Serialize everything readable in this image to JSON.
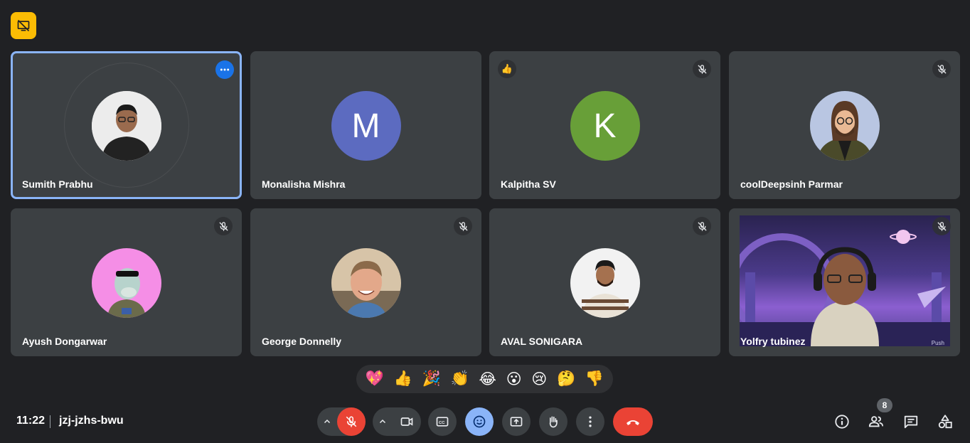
{
  "meeting": {
    "time": "11:22",
    "code": "jzj-jzhs-bwu",
    "participant_count": "8"
  },
  "participants": [
    {
      "name": "Sumith Prabhu"
    },
    {
      "name": "Monalisha Mishra",
      "initial": "M",
      "color": "#5c6bc0"
    },
    {
      "name": "Kalpitha SV",
      "initial": "K",
      "color": "#689f38",
      "reaction": "👍"
    },
    {
      "name": "coolDeepsinh Parmar"
    },
    {
      "name": "Ayush Dongarwar"
    },
    {
      "name": "George Donnelly"
    },
    {
      "name": "AVAL SONIGARA"
    },
    {
      "name": "Yolfry tubinez",
      "watermark": "Push"
    }
  ],
  "reactions": [
    "💖",
    "👍",
    "🎉",
    "👏",
    "😂",
    "😮",
    "😢",
    "🤔",
    "👎"
  ],
  "icons": {
    "presenting": "no-presenting-icon",
    "mic": "mic-off-icon",
    "camera": "videocam-icon",
    "captions": "closed-caption-icon",
    "emoji": "emoji-icon",
    "present": "present-screen-icon",
    "hand": "raise-hand-icon",
    "more": "more-vert-icon",
    "leave": "call-end-icon",
    "info": "info-icon",
    "people": "people-icon",
    "chat": "chat-icon",
    "activities": "activities-icon"
  },
  "colors": {
    "background": "#202124",
    "tile": "#3c4043",
    "active_border": "#8ab4f8",
    "danger": "#ea4335",
    "accent": "#8ab4f8",
    "badge": "#fbbc04"
  }
}
